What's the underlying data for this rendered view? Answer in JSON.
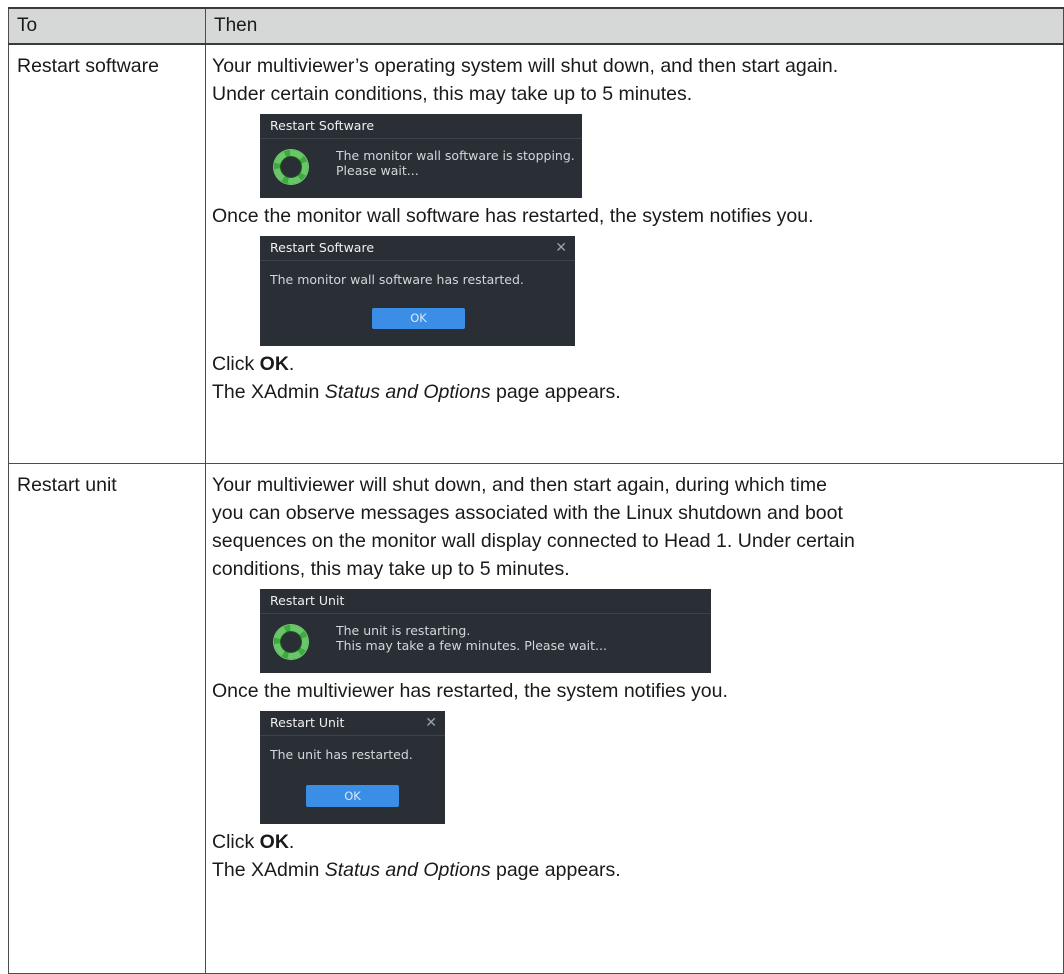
{
  "table": {
    "headers": {
      "to": "To",
      "then": "Then"
    },
    "rows": [
      {
        "to": "Restart software",
        "intro": [
          "Your multiviewer’s operating system will shut down, and then start again.",
          "Under certain conditions, this may take up to 5 minutes."
        ],
        "dialog_progress": {
          "title": "Restart Software",
          "message": [
            "The monitor wall software is stopping.",
            "Please wait..."
          ]
        },
        "notify": "Once the monitor wall software has restarted, the system notifies you.",
        "dialog_done": {
          "title": "Restart Software",
          "close": "✕",
          "message": "The monitor wall software has restarted.",
          "ok": "OK"
        },
        "click_prefix": "Click ",
        "click_bold": "OK",
        "click_suffix": ".",
        "result_prefix": "The XAdmin ",
        "result_italic": "Status and Options",
        "result_suffix": " page appears."
      },
      {
        "to": "Restart unit",
        "intro": [
          "Your multiviewer will shut down, and then start again, during which time",
          "you can observe messages associated with the Linux shutdown and boot",
          "sequences on the monitor wall display connected to Head 1. Under certain",
          "conditions, this may take up to 5 minutes."
        ],
        "dialog_progress": {
          "title": "Restart Unit",
          "message": [
            "The unit is restarting.",
            "This may take a few minutes. Please wait..."
          ]
        },
        "notify": "Once the multiviewer has restarted, the system notifies you.",
        "dialog_done": {
          "title": "Restart Unit",
          "close": "✕",
          "message": "The unit has restarted.",
          "ok": "OK"
        },
        "click_prefix": "Click ",
        "click_bold": "OK",
        "click_suffix": ".",
        "result_prefix": "The XAdmin ",
        "result_italic": "Status and Options",
        "result_suffix": " page appears."
      }
    ]
  }
}
